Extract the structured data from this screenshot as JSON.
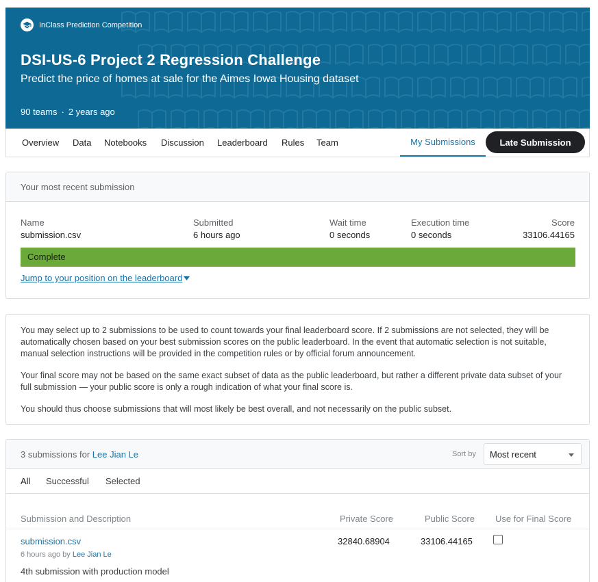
{
  "banner": {
    "type_label": "InClass Prediction Competition",
    "title": "DSI-US-6 Project 2 Regression Challenge",
    "subtitle": "Predict the price of homes at sale for the Aimes Iowa Housing dataset",
    "teams": "90 teams",
    "separator": "·",
    "age": "2 years ago",
    "colors": {
      "background": "#0e6a94",
      "text": "#ffffff"
    }
  },
  "nav": {
    "tabs": [
      "Overview",
      "Data",
      "Notebooks",
      "Discussion",
      "Leaderboard",
      "Rules",
      "Team"
    ],
    "active_tab": "My Submissions",
    "late_submission": "Late Submission",
    "colors": {
      "active": "#1c74a5",
      "button_bg": "#202124"
    }
  },
  "recent": {
    "header": "Your most recent submission",
    "columns": [
      {
        "label": "Name",
        "value": "submission.csv"
      },
      {
        "label": "Submitted",
        "value": "6 hours ago"
      },
      {
        "label": "Wait time",
        "value": "0 seconds"
      },
      {
        "label": "Execution time",
        "value": "0 seconds"
      },
      {
        "label": "Score",
        "value": "33106.44165"
      }
    ],
    "status": "Complete",
    "status_color": "#6ba93a",
    "jump_link": "Jump to your position on the leaderboard"
  },
  "info": {
    "paragraphs": [
      "You may select up to 2 submissions to be used to count towards your final leaderboard score. If 2 submissions are not selected, they will be automatically chosen based on your best submission scores on the public leaderboard. In the event that automatic selection is not suitable, manual selection instructions will be provided in the competition rules or by official forum announcement.",
      "Your final score may not be based on the same exact subset of data as the public leaderboard, but rather a different private data subset of your full submission — your public score is only a rough indication of what your final score is.",
      "You should thus choose submissions that will most likely be best overall, and not necessarily on the public subset."
    ]
  },
  "submissions": {
    "count_text": "3 submissions for",
    "user": "Lee Jian Le",
    "sort_label": "Sort by",
    "sort_value": "Most recent",
    "filters": [
      "All",
      "Successful",
      "Selected"
    ],
    "active_filter": "All",
    "columns": {
      "description": "Submission and Description",
      "private": "Private Score",
      "public": "Public Score",
      "final": "Use for Final Score"
    },
    "rows": [
      {
        "file": "submission.csv",
        "ago": "6 hours ago",
        "by": "by",
        "user": "Lee Jian Le",
        "description": "4th submission with production model",
        "private_score": "32840.68904",
        "public_score": "33106.44165",
        "selected": false
      }
    ]
  }
}
